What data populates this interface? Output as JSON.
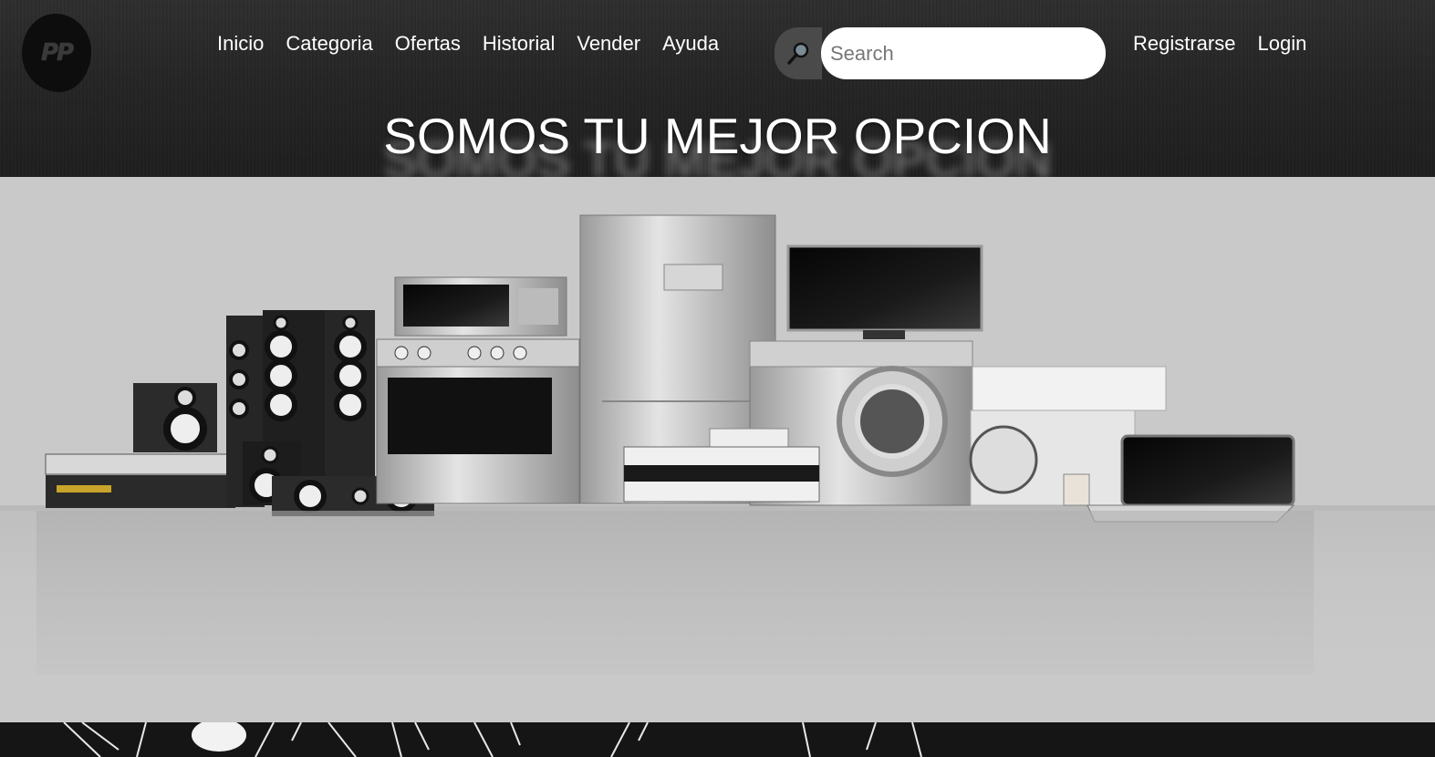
{
  "brand": {
    "logo_text": "PP"
  },
  "nav": {
    "items": [
      "Inicio",
      "Categoria",
      "Ofertas",
      "Historial",
      "Vender",
      "Ayuda"
    ]
  },
  "search": {
    "placeholder": "Search",
    "value": ""
  },
  "auth": {
    "register_label": "Registrarse",
    "login_label": "Login"
  },
  "hero": {
    "tagline": "SOMOS TU MEJOR OPCION",
    "image_alt": "Electrodomésticos"
  },
  "colors": {
    "header_bg": "#232323",
    "hero_bg": "#c9c9c9",
    "search_button_bg": "#4a4a4a"
  }
}
